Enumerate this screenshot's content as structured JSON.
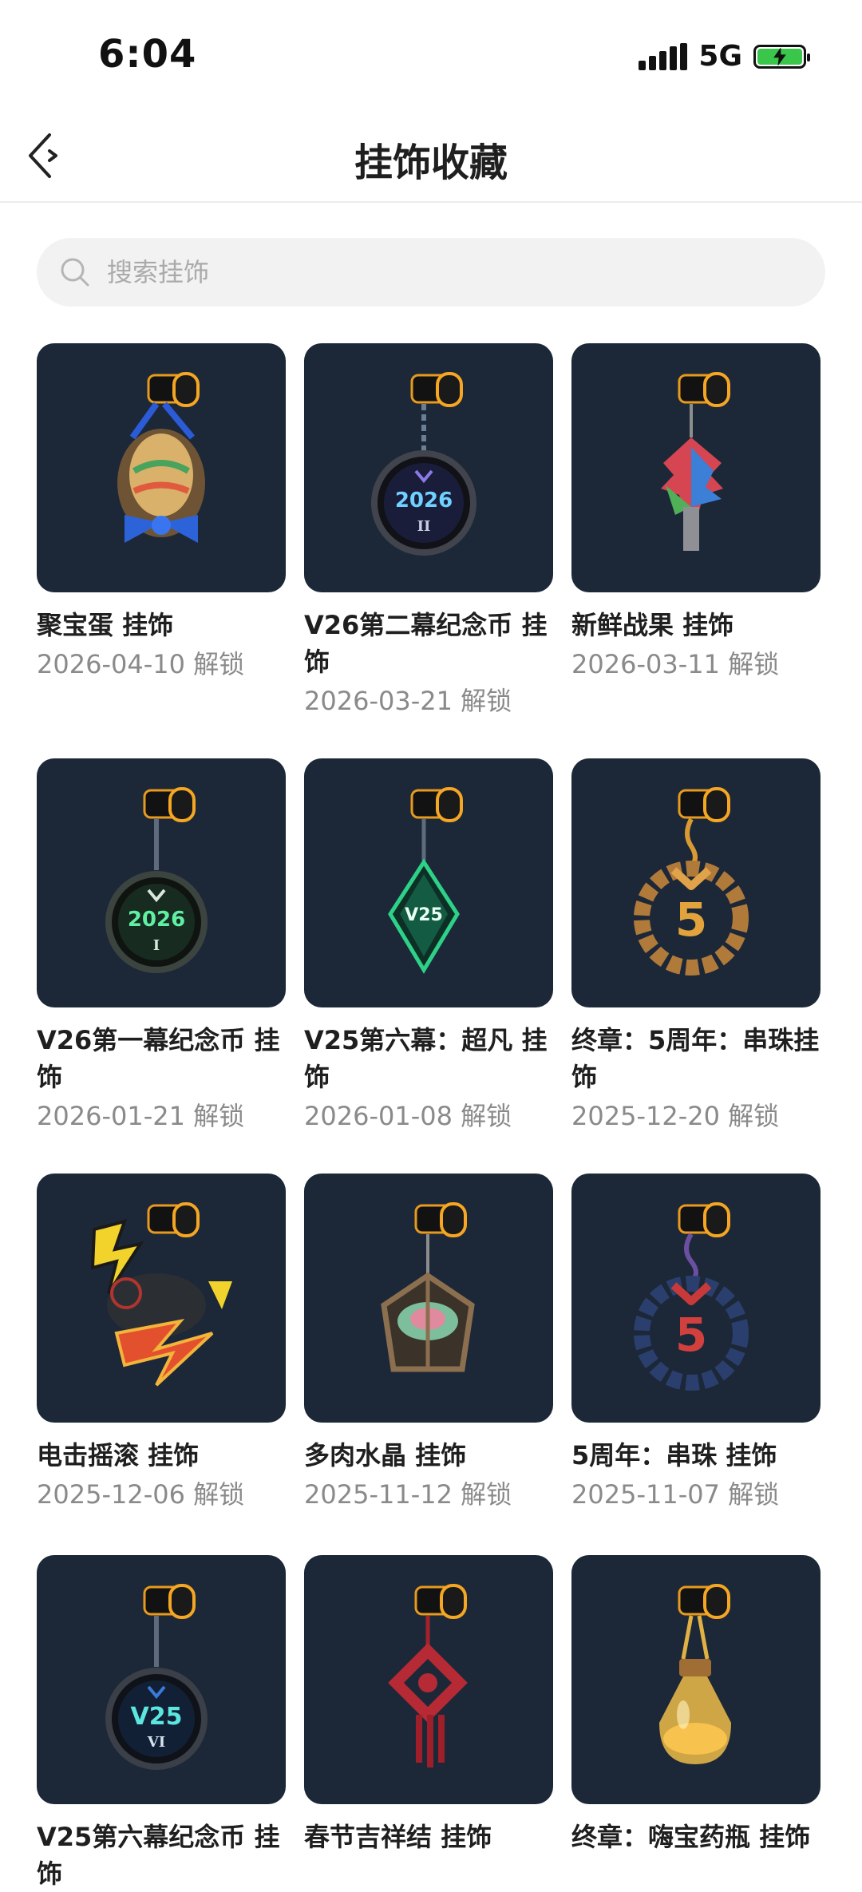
{
  "status_bar": {
    "time": "6:04",
    "network": "5G"
  },
  "header": {
    "title": "挂饰收藏"
  },
  "search": {
    "placeholder": "搜索挂饰"
  },
  "unlock_suffix": "解锁",
  "items": [
    {
      "name": "聚宝蛋 挂饰",
      "date": "2026-04-10 解锁",
      "art": "egg"
    },
    {
      "name": "V26第二幕纪念币 挂饰",
      "date": "2026-03-21 解锁",
      "art": "coin-2026-ii"
    },
    {
      "name": "新鲜战果 挂饰",
      "date": "2026-03-11 解锁",
      "art": "fruit"
    },
    {
      "name": "V26第一幕纪念币 挂饰",
      "date": "2026-01-21 解锁",
      "art": "coin-2026-i"
    },
    {
      "name": "V25第六幕：超凡 挂饰",
      "date": "2026-01-08 解锁",
      "art": "v25-diamond"
    },
    {
      "name": "终章：5周年：串珠挂饰",
      "date": "2025-12-20 解锁",
      "art": "bead-5-gold"
    },
    {
      "name": "电击摇滚 挂饰",
      "date": "2025-12-06 解锁",
      "art": "electric-rock"
    },
    {
      "name": "多肉水晶 挂饰",
      "date": "2025-11-12 解锁",
      "art": "succulent"
    },
    {
      "name": "5周年：串珠 挂饰",
      "date": "2025-11-07 解锁",
      "art": "bead-5-red"
    },
    {
      "name": "V25第六幕纪念币 挂饰",
      "date": "",
      "art": "coin-v25-vi"
    },
    {
      "name": "春节吉祥结 挂饰",
      "date": "",
      "art": "chinese-knot"
    },
    {
      "name": "终章：嗨宝药瓶 挂饰",
      "date": "",
      "art": "potion"
    }
  ],
  "colors": {
    "card_bg": "#1c2838",
    "accent_orange": "#f5a623",
    "date_gray": "#8a8a8a"
  }
}
